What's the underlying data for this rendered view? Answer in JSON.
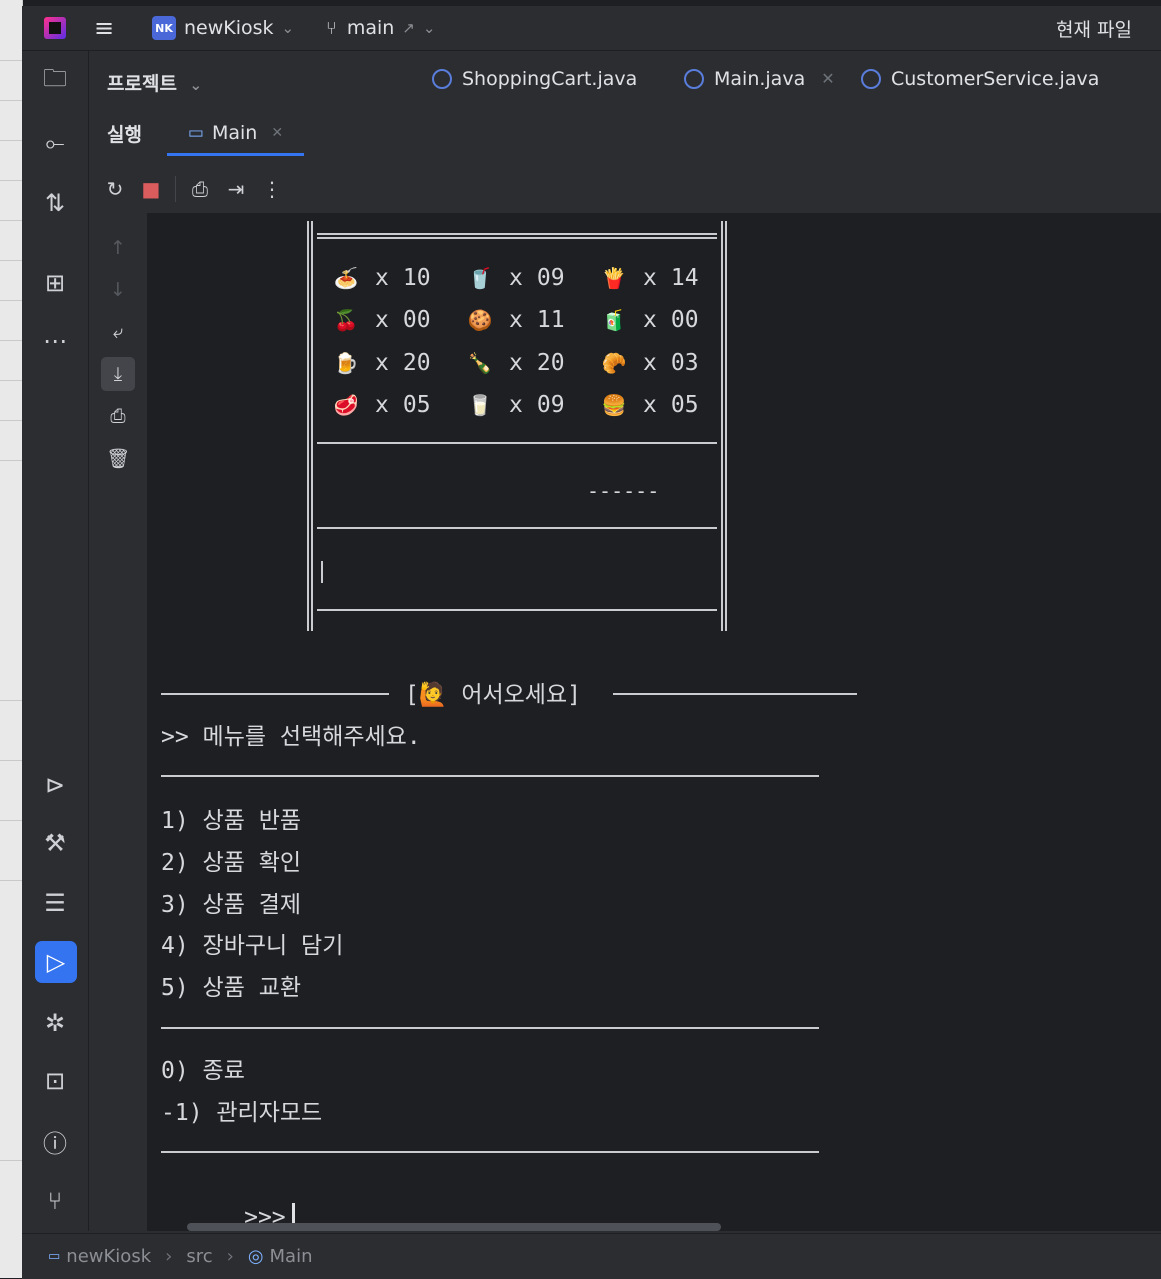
{
  "titlebar": {
    "project_badge": "NK",
    "project_name": "newKiosk",
    "branch": "main",
    "current_file_label": "현재 파일"
  },
  "panel": {
    "project_label": "프로젝트",
    "run_label": "실행",
    "run_tab": "Main"
  },
  "editor_tabs": [
    {
      "label": "ShoppingCart.java"
    },
    {
      "label": "Main.java"
    },
    {
      "label": "CustomerService.java"
    }
  ],
  "inventory": [
    [
      {
        "emoji": "🍝",
        "qty": "10"
      },
      {
        "emoji": "🥤",
        "qty": "09"
      },
      {
        "emoji": "🍟",
        "qty": "14"
      }
    ],
    [
      {
        "emoji": "🍒",
        "qty": "00"
      },
      {
        "emoji": "🍪",
        "qty": "11"
      },
      {
        "emoji": "🧃",
        "qty": "00"
      }
    ],
    [
      {
        "emoji": "🍺",
        "qty": "20"
      },
      {
        "emoji": "🍾",
        "qty": "20"
      },
      {
        "emoji": "🥐",
        "qty": "03"
      }
    ],
    [
      {
        "emoji": "🥩",
        "qty": "05"
      },
      {
        "emoji": "🥛",
        "qty": "09"
      },
      {
        "emoji": "🍔",
        "qty": "05"
      }
    ]
  ],
  "inv_multiplier": "x",
  "box_dashes": "------",
  "console": {
    "welcome": "[🙋 어서오세요]",
    "prompt_text": ">> 메뉴를 선택해주세요.",
    "menu": [
      "1) 상품 반품",
      "2) 상품 확인",
      "3) 상품 결제",
      "4) 장바구니 담기",
      "5) 상품 교환"
    ],
    "exit_items": [
      "0) 종료",
      "-1) 관리자모드"
    ],
    "input_prompt": ">>>"
  },
  "statusbar": {
    "crumbs": [
      "newKiosk",
      "src",
      "Main"
    ]
  },
  "colors": {
    "accent": "#3574f0",
    "stop": "#db5c5c",
    "background": "#1e1f22",
    "panel": "#2b2d30"
  }
}
